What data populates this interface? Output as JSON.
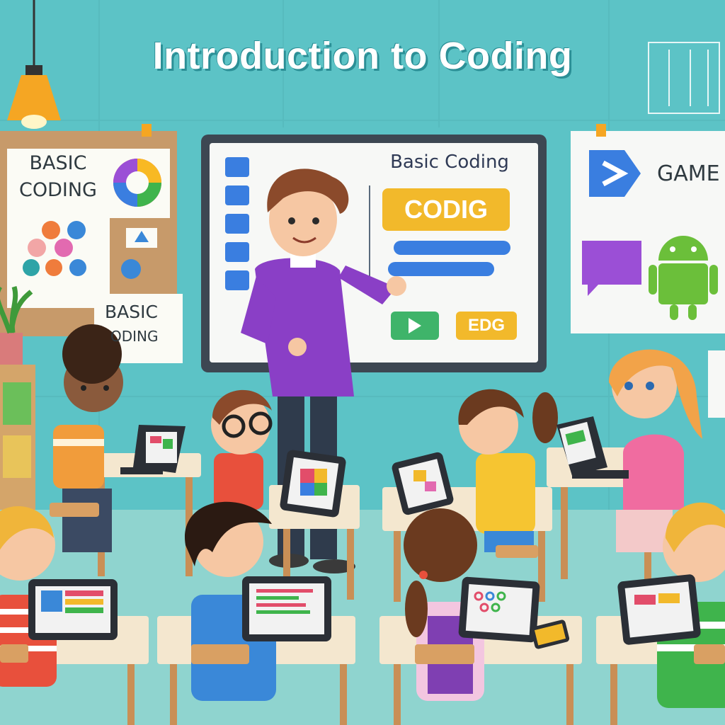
{
  "title": "Introduction to Coding",
  "left_poster": {
    "line1": "BASIC",
    "line2": "CODING"
  },
  "left_card": {
    "line1": "BASIC",
    "line2": "ODING"
  },
  "whiteboard": {
    "heading": "Basic Coding",
    "main_button": "CODIG",
    "small_button": "EDG",
    "play_icon": "play-icon"
  },
  "right_poster": {
    "label": "GAME"
  },
  "colors": {
    "wall": "#5cc3c6",
    "floor": "#8fd4cf",
    "accent_yellow": "#f2b92b",
    "teacher_sweater": "#8a3fc6",
    "board_frame": "#3d4752"
  }
}
